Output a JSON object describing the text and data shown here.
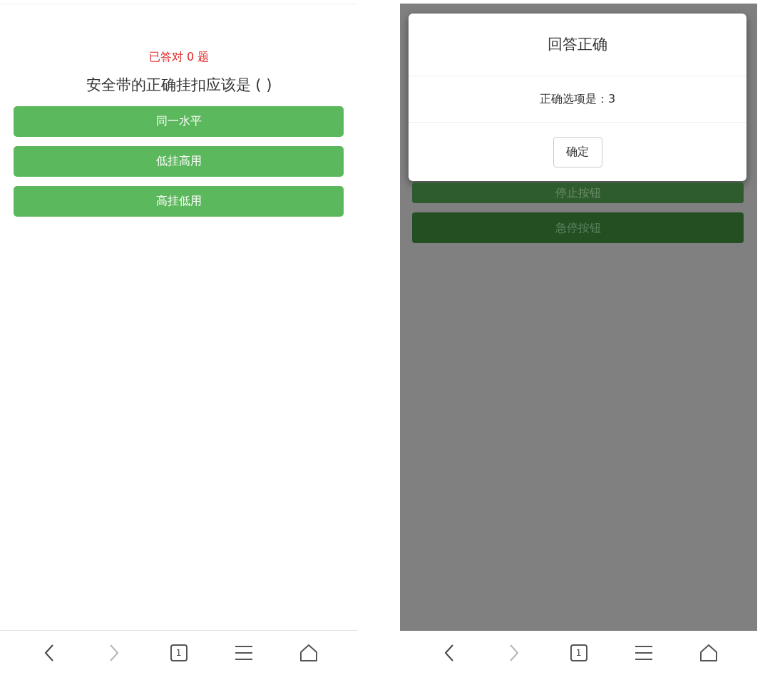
{
  "left_screen": {
    "score": "已答对 0 题",
    "question": "安全带的正确挂扣应该是 ( )",
    "options": [
      {
        "label": "同一水平"
      },
      {
        "label": "低挂高用"
      },
      {
        "label": "高挂低用"
      }
    ],
    "nav_bar": {
      "back_disabled": false,
      "forward_disabled": true,
      "tab_count": "1"
    }
  },
  "right_screen": {
    "dialog": {
      "title": "回答正确",
      "message": "正确选项是：3",
      "button": "确定"
    },
    "background_buttons": [
      {
        "label": "停止按钮"
      },
      {
        "label": "急停按钮"
      }
    ],
    "nav_bar": {
      "back_disabled": false,
      "forward_disabled": true,
      "tab_count": "1"
    }
  }
}
